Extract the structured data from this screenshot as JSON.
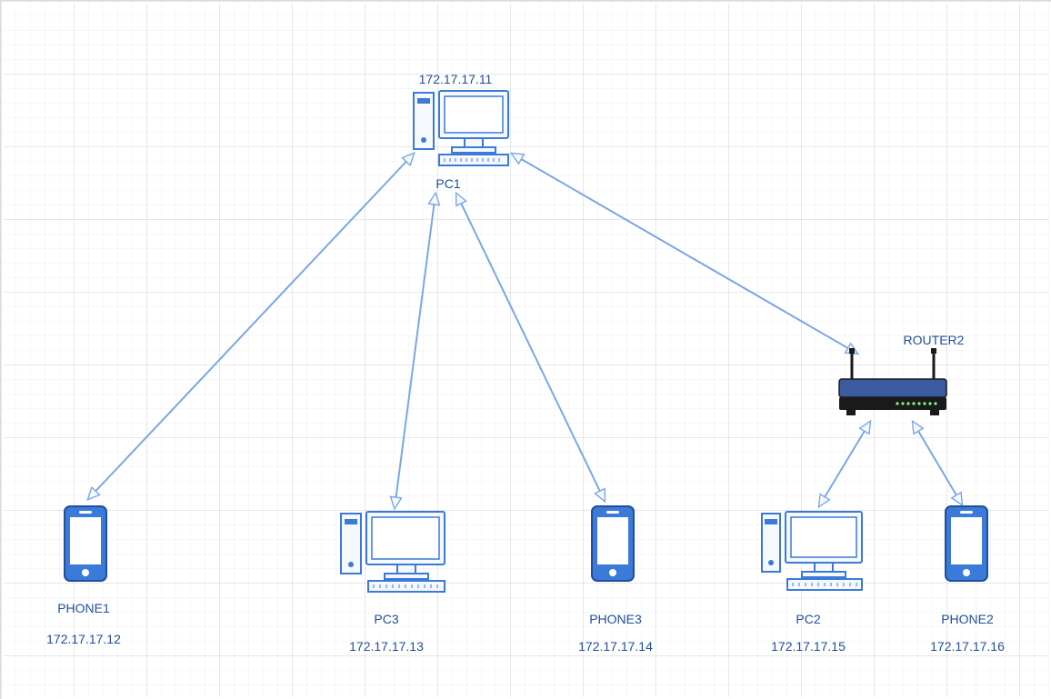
{
  "nodes": {
    "pc1": {
      "name": "PC1",
      "ip": "172.17.17.11"
    },
    "phone1": {
      "name": "PHONE1",
      "ip": "172.17.17.12"
    },
    "pc3": {
      "name": "PC3",
      "ip": "172.17.17.13"
    },
    "phone3": {
      "name": "PHONE3",
      "ip": "172.17.17.14"
    },
    "pc2": {
      "name": "PC2",
      "ip": "172.17.17.15"
    },
    "phone2": {
      "name": "PHONE2",
      "ip": "172.17.17.16"
    },
    "router2": {
      "name": "ROUTER2"
    }
  },
  "colors": {
    "stroke": "#7aa7e8",
    "fill_light": "#f5f8fd",
    "accent": "#3b7ad9",
    "dark": "#1a1a1a"
  }
}
